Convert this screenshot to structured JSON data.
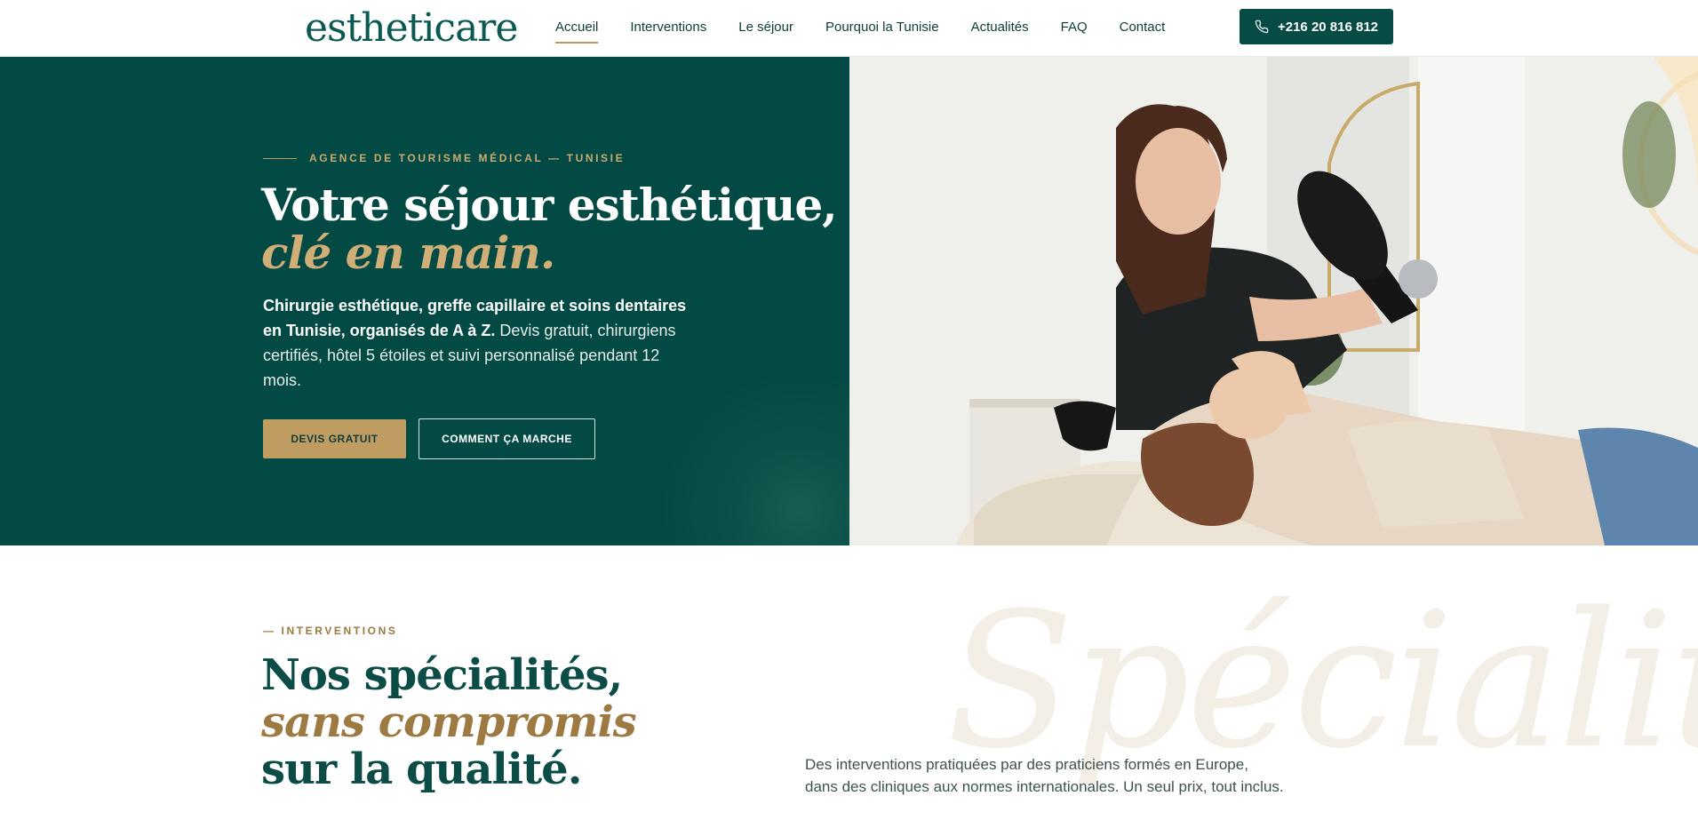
{
  "brand": {
    "logo": "estheticare"
  },
  "nav": {
    "items": [
      {
        "label": "Accueil",
        "active": true
      },
      {
        "label": "Interventions"
      },
      {
        "label": "Le séjour"
      },
      {
        "label": "Pourquoi la Tunisie"
      },
      {
        "label": "Actualités"
      },
      {
        "label": "FAQ"
      },
      {
        "label": "Contact"
      }
    ],
    "phone": "+216 20 816 812"
  },
  "hero": {
    "eyebrow": "AGENCE DE TOURISME MÉDICAL — TUNISIE",
    "title_line1": "Votre séjour esthétique,",
    "title_line2": "clé en main.",
    "desc_bold": "Chirurgie esthétique, greffe capillaire et soins dentaires en Tunisie, organisés de A à Z.",
    "desc_rest": " Devis gratuit, chirurgiens certifiés, hôtel 5 étoiles et suivi personnalisé pendant 12 mois.",
    "cta_primary": "DEVIS GRATUIT",
    "cta_secondary": "COMMENT ÇA MARCHE"
  },
  "interventions": {
    "eyebrow": "— INTERVENTIONS",
    "title_part1": "Nos spécialités, ",
    "title_accent": "sans compromis",
    "title_part2": "sur la qualité.",
    "watermark": "Spécialité",
    "description": "Des interventions pratiquées par des praticiens formés en Europe, dans des cliniques aux normes internationales. Un seul prix, tout inclus."
  },
  "colors": {
    "primary": "#044a44",
    "accent_gold": "#bf9d62"
  }
}
